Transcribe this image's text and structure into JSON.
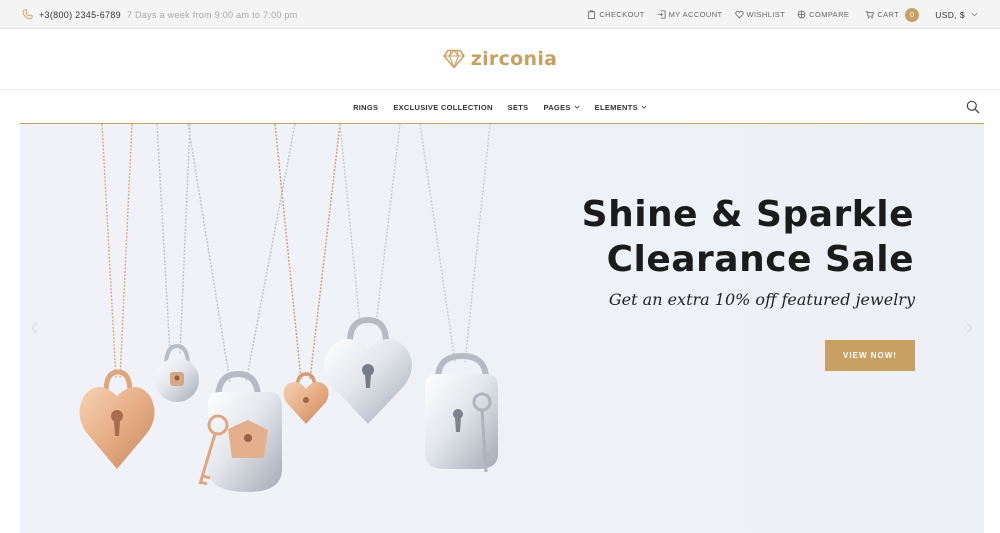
{
  "topbar": {
    "phone": "+3(800) 2345-6789",
    "hours": "7 Days a week from 9:00 am to 7:00 pm",
    "links": {
      "checkout": "CHECKOUT",
      "account": "MY ACCOUNT",
      "wishlist": "WISHLIST",
      "compare": "COMPARE",
      "cart": "CART"
    },
    "cart_count": "0",
    "currency": "USD, $"
  },
  "logo": {
    "text": "zirconia"
  },
  "nav": {
    "items": [
      {
        "label": "RINGS"
      },
      {
        "label": "EXCLUSIVE COLLECTION"
      },
      {
        "label": "SETS"
      },
      {
        "label": "PAGES"
      },
      {
        "label": "ELEMENTS"
      }
    ]
  },
  "hero": {
    "title_line1": "Shine & Sparkle",
    "title_line2": "Clearance Sale",
    "subtitle": "Get an extra 10% off featured jewelry",
    "button": "VIEW NOW!"
  },
  "colors": {
    "accent": "#c9a063",
    "topbar_bg": "#f4f4f4",
    "hero_bg": "#eef1f6",
    "text_dark": "#1b1b1b"
  },
  "icons": [
    "phone-icon",
    "checkout-icon",
    "account-icon",
    "wishlist-icon",
    "compare-icon",
    "cart-icon",
    "chevron-down-icon",
    "diamond-logo-icon",
    "search-icon",
    "arrow-left-icon",
    "arrow-right-icon"
  ]
}
